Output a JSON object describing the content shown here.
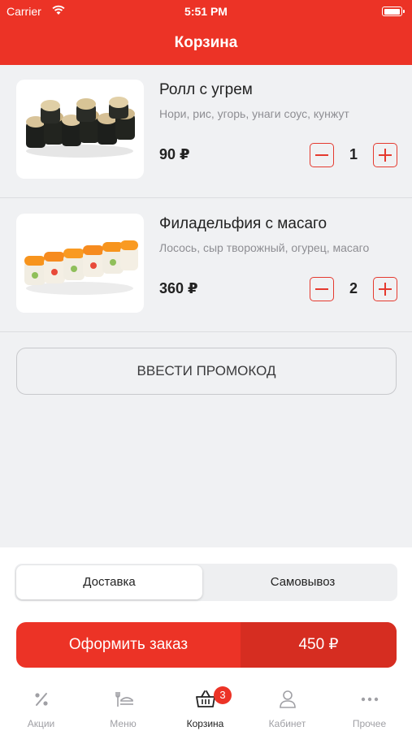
{
  "status_bar": {
    "carrier": "Carrier",
    "time": "5:51 PM"
  },
  "header": {
    "title": "Корзина"
  },
  "cart": {
    "items": [
      {
        "name": "Ролл с угрем",
        "description": "Нори, рис, угорь, унаги соус, кунжут",
        "price": "90 ₽",
        "quantity": "1",
        "image": "eel-roll-image"
      },
      {
        "name": "Филадельфия с масаго",
        "description": "Лосось, сыр творожный, огурец, масаго",
        "price": "360 ₽",
        "quantity": "2",
        "image": "philadelphia-roll-image"
      }
    ]
  },
  "promo": {
    "label": "ВВЕСТИ ПРОМОКОД"
  },
  "delivery": {
    "options": [
      "Доставка",
      "Самовывоз"
    ],
    "selected": "Доставка"
  },
  "order": {
    "label": "Оформить заказ",
    "total": "450 ₽"
  },
  "tabbar": {
    "items": [
      {
        "label": "Акции",
        "icon": "percent-icon"
      },
      {
        "label": "Меню",
        "icon": "menu-icon"
      },
      {
        "label": "Корзина",
        "icon": "basket-icon",
        "badge": "3",
        "active": true
      },
      {
        "label": "Кабинет",
        "icon": "user-icon"
      },
      {
        "label": "Прочее",
        "icon": "more-icon"
      }
    ]
  },
  "colors": {
    "accent": "#ec3326",
    "accent_dark": "#d62d21",
    "background": "#f0f1f3"
  }
}
